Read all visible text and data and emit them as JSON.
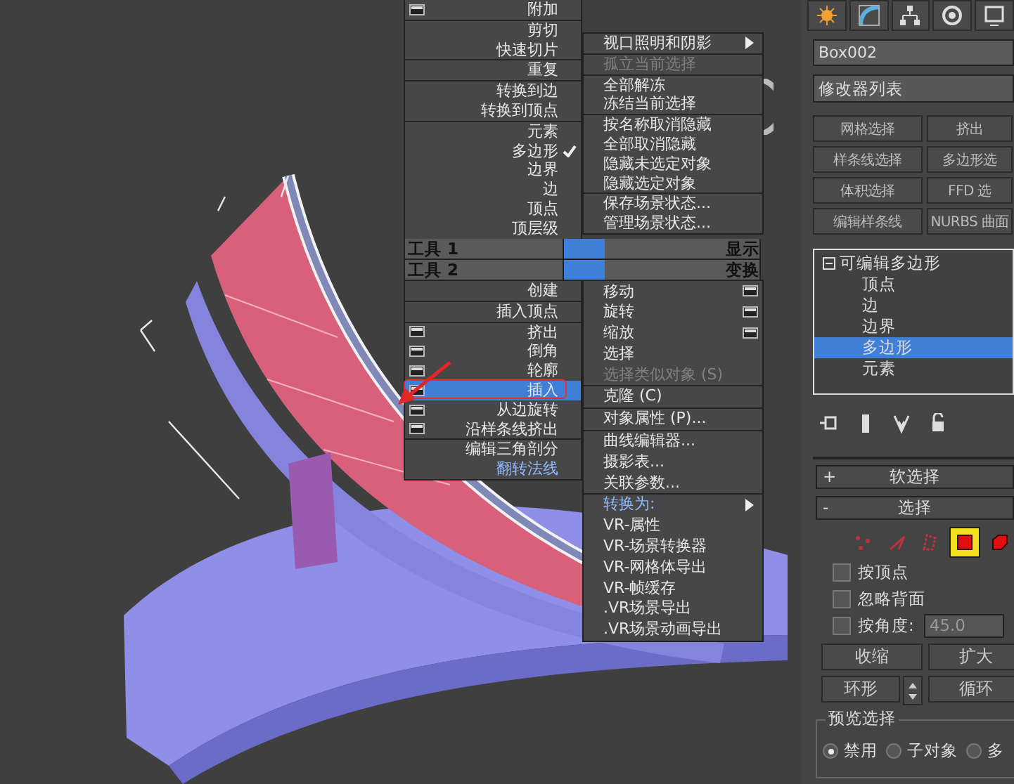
{
  "viewport": {
    "quad_menu": {
      "top_left": {
        "groups": [
          [
            {
              "label": "附加",
              "kind": "settings",
              "selected": false,
              "checked": false
            }
          ],
          [
            {
              "label": "剪切",
              "kind": "plain",
              "selected": false,
              "checked": false
            },
            {
              "label": "快速切片",
              "kind": "plain",
              "selected": false,
              "checked": false
            }
          ],
          [
            {
              "label": "重复",
              "kind": "plain",
              "selected": false,
              "checked": false
            }
          ],
          [
            {
              "label": "转换到边",
              "kind": "plain",
              "selected": false,
              "checked": false
            },
            {
              "label": "转换到顶点",
              "kind": "plain",
              "selected": false,
              "checked": false
            }
          ],
          [
            {
              "label": "元素",
              "kind": "plain",
              "selected": false,
              "checked": false
            },
            {
              "label": "多边形",
              "kind": "plain",
              "selected": false,
              "checked": true
            },
            {
              "label": "边界",
              "kind": "plain",
              "selected": false,
              "checked": false
            },
            {
              "label": "边",
              "kind": "plain",
              "selected": false,
              "checked": false
            },
            {
              "label": "顶点",
              "kind": "plain",
              "selected": false,
              "checked": false
            },
            {
              "label": "顶层级",
              "kind": "plain",
              "selected": false,
              "checked": false
            }
          ]
        ]
      },
      "top_right": {
        "groups": [
          [
            {
              "label": "视口照明和阴影",
              "kind": "submenu",
              "selected": false,
              "checked": false
            }
          ],
          [
            {
              "label": "孤立当前选择",
              "kind": "disabled",
              "selected": false,
              "checked": false
            }
          ],
          [
            {
              "label": "全部解冻",
              "kind": "plain",
              "selected": false,
              "checked": false
            },
            {
              "label": "冻结当前选择",
              "kind": "plain",
              "selected": false,
              "checked": false
            }
          ],
          [
            {
              "label": "按名称取消隐藏",
              "kind": "plain",
              "selected": false,
              "checked": false
            },
            {
              "label": "全部取消隐藏",
              "kind": "plain",
              "selected": false,
              "checked": false
            },
            {
              "label": "隐藏未选定对象",
              "kind": "plain",
              "selected": false,
              "checked": false
            },
            {
              "label": "隐藏选定对象",
              "kind": "plain",
              "selected": false,
              "checked": false
            }
          ],
          [
            {
              "label": "保存场景状态...",
              "kind": "plain",
              "selected": false,
              "checked": false
            },
            {
              "label": "管理场景状态...",
              "kind": "plain",
              "selected": false,
              "checked": false
            }
          ]
        ]
      },
      "headers": [
        {
          "left": "工具 1",
          "right": "显示"
        },
        {
          "left": "工具 2",
          "right": "变换"
        }
      ],
      "bottom_left": {
        "groups": [
          [
            {
              "label": "创建",
              "kind": "plain",
              "selected": false,
              "checked": false
            }
          ],
          [
            {
              "label": "插入顶点",
              "kind": "plain",
              "selected": false,
              "checked": false
            }
          ],
          [
            {
              "label": "挤出",
              "kind": "settings",
              "selected": false,
              "checked": false
            },
            {
              "label": "倒角",
              "kind": "settings",
              "selected": false,
              "checked": false
            },
            {
              "label": "轮廓",
              "kind": "settings",
              "selected": false,
              "checked": false
            },
            {
              "label": "插入",
              "kind": "settings",
              "selected": true,
              "checked": false
            },
            {
              "label": "从边旋转",
              "kind": "settings",
              "selected": false,
              "checked": false
            },
            {
              "label": "沿样条线挤出",
              "kind": "settings",
              "selected": false,
              "checked": false
            }
          ],
          [
            {
              "label": "编辑三角剖分",
              "kind": "plain",
              "selected": false,
              "checked": false
            },
            {
              "label": "翻转法线",
              "kind": "recent",
              "selected": false,
              "checked": false
            }
          ]
        ]
      },
      "bottom_right": {
        "groups": [
          [
            {
              "label": "移动",
              "kind": "settings",
              "selected": false,
              "checked": false
            },
            {
              "label": "旋转",
              "kind": "settings",
              "selected": false,
              "checked": false
            },
            {
              "label": "缩放",
              "kind": "settings",
              "selected": false,
              "checked": false
            },
            {
              "label": "选择",
              "kind": "plain",
              "selected": false,
              "checked": false
            },
            {
              "label": "选择类似对象 (S)",
              "kind": "disabled",
              "selected": false,
              "checked": false
            }
          ],
          [
            {
              "label": "克隆 (C)",
              "kind": "plain",
              "selected": false,
              "checked": false
            }
          ],
          [
            {
              "label": "对象属性 (P)...",
              "kind": "plain",
              "selected": false,
              "checked": false
            }
          ],
          [
            {
              "label": "曲线编辑器...",
              "kind": "plain",
              "selected": false,
              "checked": false
            },
            {
              "label": "摄影表...",
              "kind": "plain",
              "selected": false,
              "checked": false
            },
            {
              "label": "关联参数...",
              "kind": "plain",
              "selected": false,
              "checked": false
            }
          ],
          [
            {
              "label": "转换为:",
              "kind": "recent_submenu",
              "selected": false,
              "checked": false
            },
            {
              "label": "VR-属性",
              "kind": "plain",
              "selected": false,
              "checked": false
            },
            {
              "label": "VR-场景转换器",
              "kind": "plain",
              "selected": false,
              "checked": false
            },
            {
              "label": "VR-网格体导出",
              "kind": "plain",
              "selected": false,
              "checked": false
            },
            {
              "label": "VR-帧缓存",
              "kind": "plain",
              "selected": false,
              "checked": false
            },
            {
              "label": ".VR场景导出",
              "kind": "plain",
              "selected": false,
              "checked": false
            },
            {
              "label": ".VR场景动画导出",
              "kind": "plain",
              "selected": false,
              "checked": false
            }
          ]
        ]
      }
    }
  },
  "command_panel": {
    "object_name": "Box002",
    "modifier_list": "修改器列表",
    "modifier_buttons": [
      "网格选择",
      "挤出",
      "样条线选择",
      "多边形选",
      "体积选择",
      "FFD 选",
      "编辑样条线",
      "NURBS 曲面"
    ],
    "stack": {
      "label": "可编辑多边形",
      "expanded": true,
      "children": [
        {
          "label": "顶点",
          "selected": false
        },
        {
          "label": "边",
          "selected": false
        },
        {
          "label": "边界",
          "selected": false
        },
        {
          "label": "多边形",
          "selected": true
        },
        {
          "label": "元素",
          "selected": false
        }
      ]
    },
    "rollouts": [
      {
        "sign": "+",
        "title": "软选择"
      },
      {
        "sign": "-",
        "title": "选择"
      }
    ],
    "selection": {
      "levels": [
        {
          "kind": "vertex",
          "selected": false
        },
        {
          "kind": "edge",
          "selected": false
        },
        {
          "kind": "border",
          "selected": false
        },
        {
          "kind": "polygon",
          "selected": true
        },
        {
          "kind": "element",
          "selected": false
        }
      ],
      "checkboxes": [
        {
          "label": "按顶点",
          "checked": false
        },
        {
          "label": "忽略背面",
          "checked": false
        },
        {
          "label": "按角度:",
          "checked": false,
          "value": "45.0"
        }
      ],
      "buttons": [
        "收缩",
        "扩大"
      ],
      "ring": "环形",
      "loop": "循环",
      "preview": {
        "title": "预览选择",
        "options": [
          {
            "label": "禁用",
            "selected": true
          },
          {
            "label": "子对象",
            "selected": false
          },
          {
            "label": "多",
            "selected": false
          }
        ]
      }
    }
  }
}
